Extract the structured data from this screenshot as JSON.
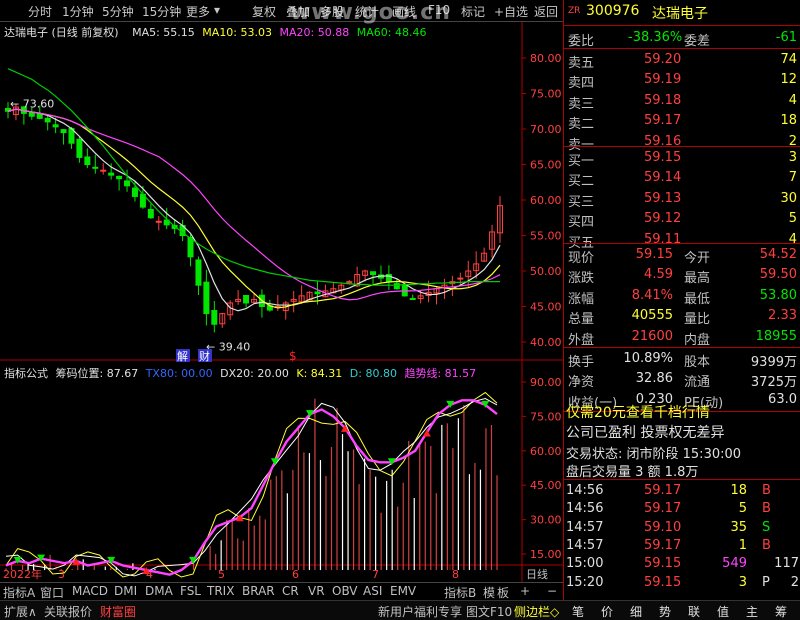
{
  "toolbar": {
    "items": [
      "分时",
      "1分钟",
      "5分钟",
      "15分钟",
      "更多"
    ],
    "more_arrow": "▾",
    "tools": [
      "复权",
      "叠加",
      "多股",
      "统计",
      "画线",
      "F10",
      "标记",
      "+自选",
      "返回"
    ],
    "watermark": "www.goo.cn"
  },
  "stock": {
    "zr": "ZR",
    "code": "300976",
    "name": "达瑞电子",
    "chart_title": "达瑞电子 (日线 前复权)"
  },
  "ma": {
    "ma5": "MA5: 55.15",
    "ma10": "MA10: 53.03",
    "ma20": "MA20: 50.88",
    "ma60": "MA60: 48.46"
  },
  "chart_labels": {
    "high": "73.60",
    "low": "39.40",
    "jie": "解",
    "cai": "财",
    "dollar": "$"
  },
  "indicator": {
    "name": "指标公式",
    "chip": "筹码位置: 87.67",
    "tx": "TX80: 00.00",
    "dx": "DX20: 20.00",
    "k": "K: 84.31",
    "d": "D: 80.80",
    "trend": "趋势线: 81.57"
  },
  "colors": {
    "up": "#ff4040",
    "down": "#00e600",
    "ma5": "#e0e0e0",
    "ma10": "#ffff33",
    "ma20": "#ff44ff",
    "ma60": "#00cc00",
    "axis": "#b00000"
  },
  "chart_data": {
    "type": "candlestick",
    "y_ticks_main": [
      "80.00",
      "75.00",
      "70.00",
      "65.00",
      "60.00",
      "55.00",
      "50.00",
      "45.00",
      "40.00"
    ],
    "y_ticks_ind": [
      "90.00",
      "75.00",
      "60.00",
      "45.00",
      "30.00",
      "15.00"
    ],
    "x_labels": [
      "2022年",
      "3",
      "4",
      "5",
      "6",
      "7",
      "8",
      "日线"
    ],
    "prices": [
      72.5,
      73.1,
      72.2,
      71.8,
      71.5,
      71.0,
      70.3,
      69.5,
      68.0,
      66.0,
      65.0,
      64.5,
      64.2,
      63.5,
      63.0,
      62.0,
      60.5,
      59.0,
      57.5,
      57.0,
      56.5,
      56.0,
      55.0,
      52.0,
      48.0,
      44.0,
      42.5,
      44.0,
      45.5,
      46.0,
      45.5,
      46.0,
      45.0,
      44.5,
      45.0,
      45.5,
      46.0,
      46.5,
      47.0,
      46.8,
      47.2,
      47.5,
      48.0,
      48.5,
      49.5,
      50.0,
      49.5,
      49.0,
      48.5,
      47.5,
      46.5,
      46.0,
      46.5,
      47.0,
      47.5,
      48.0,
      48.5,
      49.0,
      50.0,
      51.0,
      52.5,
      55.5,
      59.2
    ],
    "ma60": [
      78.5,
      78.0,
      77.5,
      77.0,
      76.2,
      75.5,
      74.6,
      73.6,
      72.6,
      71.4,
      70.2,
      68.9,
      67.6,
      66.2,
      64.8,
      63.4,
      62.1,
      60.8,
      59.6,
      58.4,
      57.3,
      56.3,
      55.4,
      54.6,
      53.8,
      53.1,
      52.5,
      51.9,
      51.4,
      51.0,
      50.6,
      50.3,
      50.0,
      49.7,
      49.5,
      49.3,
      49.1,
      48.9,
      48.7,
      48.6,
      48.5,
      48.4,
      48.3,
      48.2,
      48.1,
      48.1,
      48.0,
      48.0,
      48.0,
      48.0,
      48.1,
      48.1,
      48.2,
      48.2,
      48.3,
      48.3,
      48.4,
      48.4,
      48.5,
      48.5,
      48.5,
      48.5,
      48.5
    ],
    "trend": [
      10,
      12,
      11,
      13,
      12,
      11,
      12,
      10,
      11,
      12,
      10,
      9,
      8,
      7,
      6,
      8,
      12,
      20,
      27,
      29,
      31,
      35,
      45,
      55,
      64,
      70,
      76,
      78,
      75,
      70,
      62,
      56,
      55,
      55,
      57,
      60,
      68,
      76,
      80,
      82,
      82,
      80,
      76
    ]
  },
  "quote": {
    "weibi_label": "委比",
    "weibi": "-38.36%",
    "weicha_label": "委差",
    "weicha": "-61",
    "sells": [
      {
        "l": "卖五",
        "p": "59.20",
        "v": "74"
      },
      {
        "l": "卖四",
        "p": "59.19",
        "v": "12"
      },
      {
        "l": "卖三",
        "p": "59.18",
        "v": "4"
      },
      {
        "l": "卖二",
        "p": "59.17",
        "v": "18"
      },
      {
        "l": "卖一",
        "p": "59.16",
        "v": "2"
      }
    ],
    "buys": [
      {
        "l": "买一",
        "p": "59.15",
        "v": "3"
      },
      {
        "l": "买二",
        "p": "59.14",
        "v": "7"
      },
      {
        "l": "买三",
        "p": "59.13",
        "v": "30"
      },
      {
        "l": "买四",
        "p": "59.12",
        "v": "5"
      },
      {
        "l": "买五",
        "p": "59.11",
        "v": "4"
      }
    ],
    "stats": [
      {
        "l1": "现价",
        "v1": "59.15",
        "l2": "今开",
        "v2": "54.52",
        "c1": "red",
        "c2": "red"
      },
      {
        "l1": "涨跌",
        "v1": "4.59",
        "l2": "最高",
        "v2": "59.50",
        "c1": "red",
        "c2": "red"
      },
      {
        "l1": "涨幅",
        "v1": "8.41%",
        "l2": "最低",
        "v2": "53.80",
        "c1": "red",
        "c2": "green"
      },
      {
        "l1": "总量",
        "v1": "40555",
        "l2": "量比",
        "v2": "2.33",
        "c1": "yel",
        "c2": "red"
      },
      {
        "l1": "外盘",
        "v1": "21600",
        "l2": "内盘",
        "v2": "18955",
        "c1": "red",
        "c2": "green"
      }
    ],
    "stats2": [
      {
        "l1": "换手",
        "v1": "10.89%",
        "l2": "股本",
        "v2": "9399万"
      },
      {
        "l1": "净资",
        "v1": "32.86",
        "l2": "流通",
        "v2": "3725万"
      },
      {
        "l1": "收益(一)",
        "v1": "0.230",
        "l2": "PE(动)",
        "v2": "63.0"
      }
    ],
    "promo": "仅需20元查看千档行情",
    "company": "公司已盈利 投票权无差异",
    "trade_state": "交易状态: 闭市阶段 15:30:00",
    "after_hours": "盘后交易量 3 额 1.8万"
  },
  "ticks": [
    {
      "t": "14:56",
      "p": "59.17",
      "v": "18",
      "s": "B"
    },
    {
      "t": "14:56",
      "p": "59.17",
      "v": "5",
      "s": "B"
    },
    {
      "t": "14:57",
      "p": "59.10",
      "v": "35",
      "s": "S"
    },
    {
      "t": "14:57",
      "p": "59.17",
      "v": "1",
      "s": "B"
    },
    {
      "t": "15:00",
      "p": "59.15",
      "v": "549",
      "s": "117"
    },
    {
      "t": "15:20",
      "p": "59.15",
      "v": "3",
      "s": "P",
      "extra": "2"
    }
  ],
  "bottom_tabs": [
    "指标A",
    "窗口",
    "MACD",
    "DMI",
    "DMA",
    "FSL",
    "TRIX",
    "BRAR",
    "CR",
    "VR",
    "OBV",
    "ASI",
    "EMV",
    "指标B",
    "模",
    "板",
    "+",
    "−"
  ],
  "status": {
    "left": [
      "扩展∧",
      "关联报价",
      "财富圈"
    ],
    "mid": [
      "新用户福利专享",
      "图文F10",
      "侧边栏◇"
    ],
    "right": [
      "笔",
      "价",
      "细",
      "势",
      "联",
      "值",
      "主",
      "筹"
    ]
  }
}
